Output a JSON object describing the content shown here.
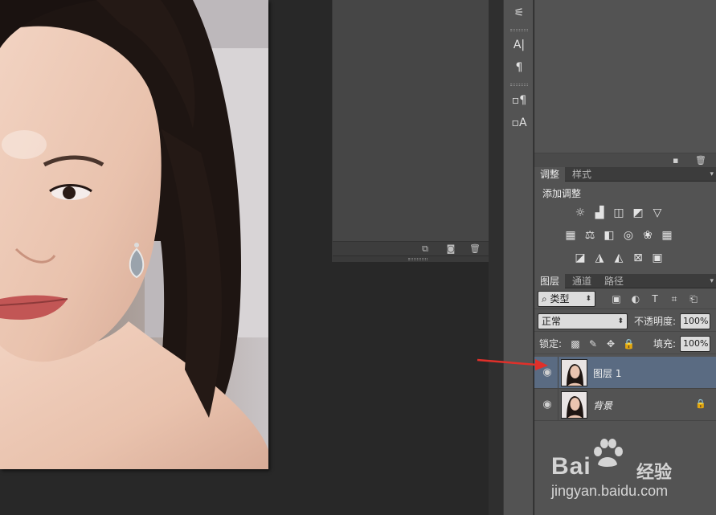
{
  "adjustments_panel": {
    "tabs": [
      "调整",
      "样式"
    ],
    "active_tab": 0,
    "title": "添加调整",
    "icon_rows": [
      [
        "brightness-contrast-icon",
        "levels-icon",
        "curves-icon",
        "exposure-icon",
        "vibrance-icon"
      ],
      [
        "hue-saturation-icon",
        "color-balance-icon",
        "black-white-icon",
        "photo-filter-icon",
        "channel-mixer-icon",
        "color-lookup-icon"
      ],
      [
        "invert-icon",
        "posterize-icon",
        "threshold-icon",
        "selective-color-icon",
        "gradient-map-icon"
      ]
    ]
  },
  "layers_panel": {
    "tabs": [
      "图层",
      "通道",
      "路径"
    ],
    "active_tab": 0,
    "filter_kind": "类型",
    "filter_icons": [
      "pixel-filter-icon",
      "adjustment-filter-icon",
      "type-filter-icon",
      "shape-filter-icon",
      "smart-object-filter-icon"
    ],
    "blend_mode": "正常",
    "opacity_label": "不透明度:",
    "opacity_value": "100%",
    "lock_label": "锁定:",
    "fill_label": "填充:",
    "fill_value": "100%",
    "layers": [
      {
        "name": "图层 1",
        "selected": true,
        "locked": false,
        "visible": true
      },
      {
        "name": "背景",
        "selected": false,
        "locked": true,
        "visible": true
      }
    ]
  },
  "tool_strip": {
    "icons": [
      "properties-sliders-icon",
      "character-icon",
      "paragraph-icon",
      "paragraph-styles-icon",
      "character-styles-icon"
    ]
  },
  "watermark": {
    "logo_text": "Bai",
    "logo_suffix": "经验",
    "url": "jingyan.baidu.com"
  },
  "colors": {
    "panel_bg": "#535353",
    "canvas_bg": "#282828",
    "selected_layer": "#5a6b82",
    "annotation_arrow": "#e0302a"
  }
}
